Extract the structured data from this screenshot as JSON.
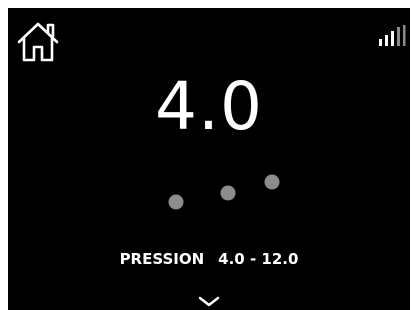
{
  "display": {
    "value": "4.0"
  },
  "pressure": {
    "label": "PRESSION",
    "range": "4.0 - 12.0"
  },
  "icons": {
    "home": "home-icon",
    "signal": "signal-strength-icon",
    "chevron": "chevron-down-icon"
  },
  "colors": {
    "background": "#000000",
    "text": "#ffffff",
    "dot": "#8c8c8c",
    "signal_bar": "#a0a0a0"
  }
}
